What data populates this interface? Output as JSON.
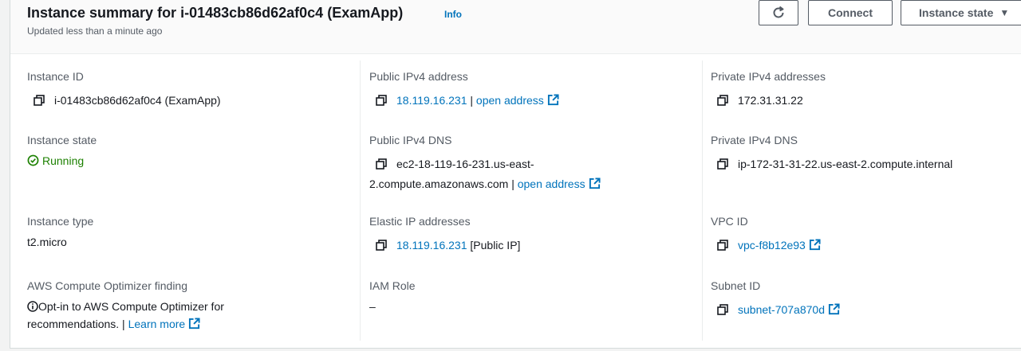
{
  "header": {
    "title": "Instance summary for i-01483cb86d62af0c4 (ExamApp)",
    "info": "Info",
    "updated": "Updated less than a minute ago",
    "connect_label": "Connect",
    "instance_state_label": "Instance state"
  },
  "col1": {
    "instance_id_label": "Instance ID",
    "instance_id_value": "i-01483cb86d62af0c4 (ExamApp)",
    "state_label": "Instance state",
    "state_value": "Running",
    "type_label": "Instance type",
    "type_value": "t2.micro",
    "optimizer_label": "AWS Compute Optimizer finding",
    "optimizer_text_1": "Opt-in to AWS Compute Optimizer for",
    "optimizer_text_2": "recommendations. |",
    "learn_more": "Learn more"
  },
  "col2": {
    "public_ip_label": "Public IPv4 address",
    "public_ip_value": "18.119.16.231",
    "separator": "|",
    "open_address": "open address",
    "public_dns_label": "Public IPv4 DNS",
    "public_dns_line1": "ec2-18-119-16-231.us-east-",
    "public_dns_line2": "2.compute.amazonaws.com",
    "elastic_label": "Elastic IP addresses",
    "elastic_value": "18.119.16.231",
    "elastic_suffix": "[Public IP]",
    "iam_label": "IAM Role",
    "iam_value": "–"
  },
  "col3": {
    "private_ip_label": "Private IPv4 addresses",
    "private_ip_value": "172.31.31.22",
    "private_dns_label": "Private IPv4 DNS",
    "private_dns_value": "ip-172-31-31-22.us-east-2.compute.internal",
    "vpc_label": "VPC ID",
    "vpc_value": "vpc-f8b12e93",
    "subnet_label": "Subnet ID",
    "subnet_value": "subnet-707a870d"
  },
  "colors": {
    "link": "#0073bb",
    "running": "#1d8102",
    "label": "#545b64"
  }
}
